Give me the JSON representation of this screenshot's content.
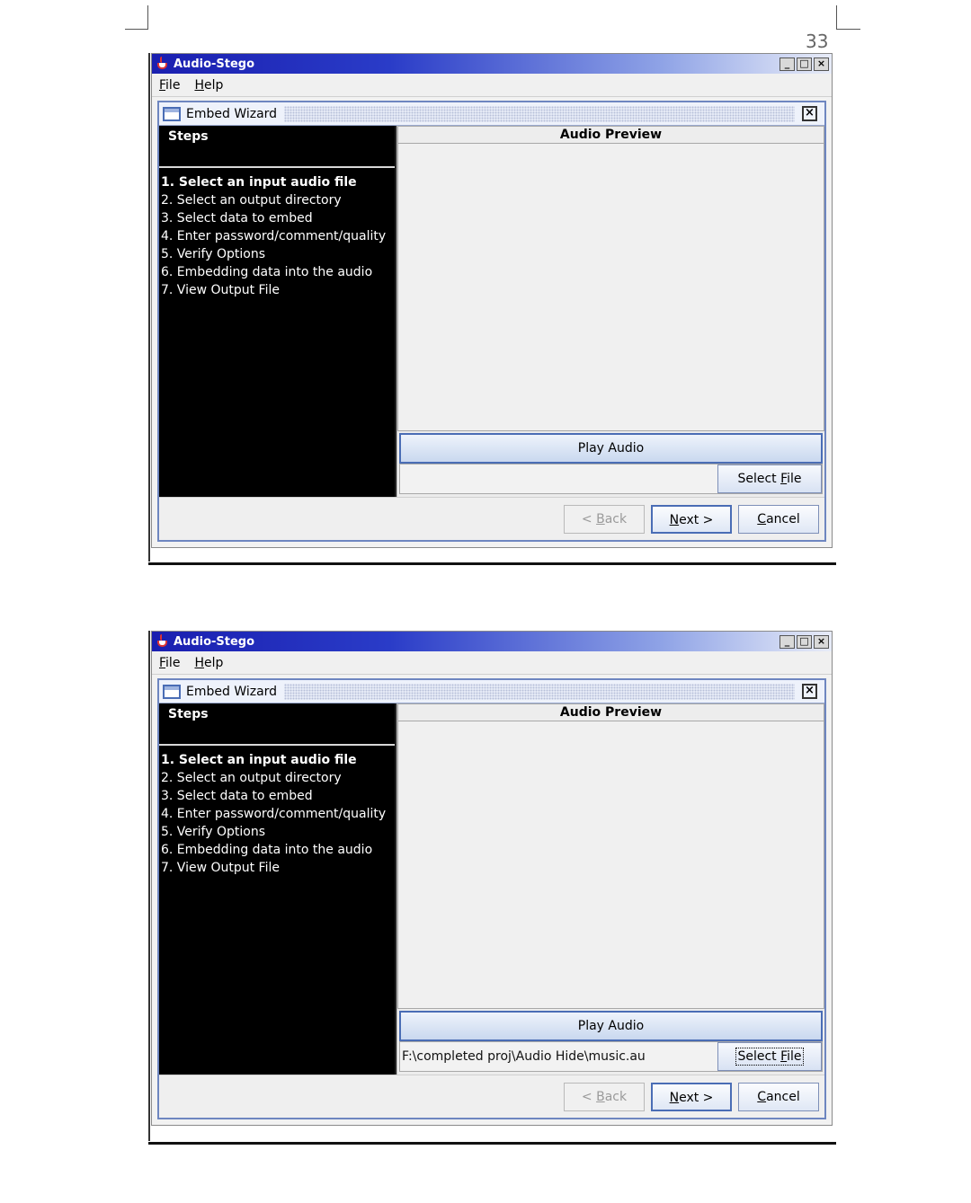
{
  "page": {
    "number": "33"
  },
  "screens": [
    {
      "window_title": "Audio-Stego",
      "window_controls": [
        "_",
        "□",
        "×"
      ],
      "menu": [
        {
          "mnemonic": "F",
          "rest": "ile"
        },
        {
          "mnemonic": "H",
          "rest": "elp"
        }
      ],
      "wizard_title": "Embed Wizard",
      "steps_header": "Steps",
      "steps": [
        "1. Select an input audio file",
        "2. Select an output directory",
        "3. Select data to embed",
        "4. Enter password/comment/quality",
        "5. Verify Options",
        "6. Embedding data into the audio",
        "7. View Output File"
      ],
      "preview_header": "Audio Preview",
      "play_label": "Play Audio",
      "file_path": "",
      "select_file": {
        "pre": "Select ",
        "mnemonic": "F",
        "post": "ile"
      },
      "back": {
        "pre": "< ",
        "mnemonic": "B",
        "post": "ack"
      },
      "next": {
        "pre": "",
        "mnemonic": "N",
        "post": "ext >"
      },
      "cancel": {
        "pre": "",
        "mnemonic": "C",
        "post": "ancel"
      }
    },
    {
      "window_title": "Audio-Stego",
      "window_controls": [
        "_",
        "□",
        "×"
      ],
      "menu": [
        {
          "mnemonic": "F",
          "rest": "ile"
        },
        {
          "mnemonic": "H",
          "rest": "elp"
        }
      ],
      "wizard_title": "Embed Wizard",
      "steps_header": "Steps",
      "steps": [
        "1. Select an input audio file",
        "2. Select an output directory",
        "3. Select data to embed",
        "4. Enter password/comment/quality",
        "5. Verify Options",
        "6. Embedding data into the audio",
        "7. View Output File"
      ],
      "preview_header": "Audio Preview",
      "play_label": "Play Audio",
      "file_path": "F:\\completed proj\\Audio Hide\\music.au",
      "select_file": {
        "pre": "Select ",
        "mnemonic": "F",
        "post": "ile"
      },
      "back": {
        "pre": "< ",
        "mnemonic": "B",
        "post": "ack"
      },
      "next": {
        "pre": "",
        "mnemonic": "N",
        "post": "ext >"
      },
      "cancel": {
        "pre": "",
        "mnemonic": "C",
        "post": "ancel"
      }
    }
  ]
}
